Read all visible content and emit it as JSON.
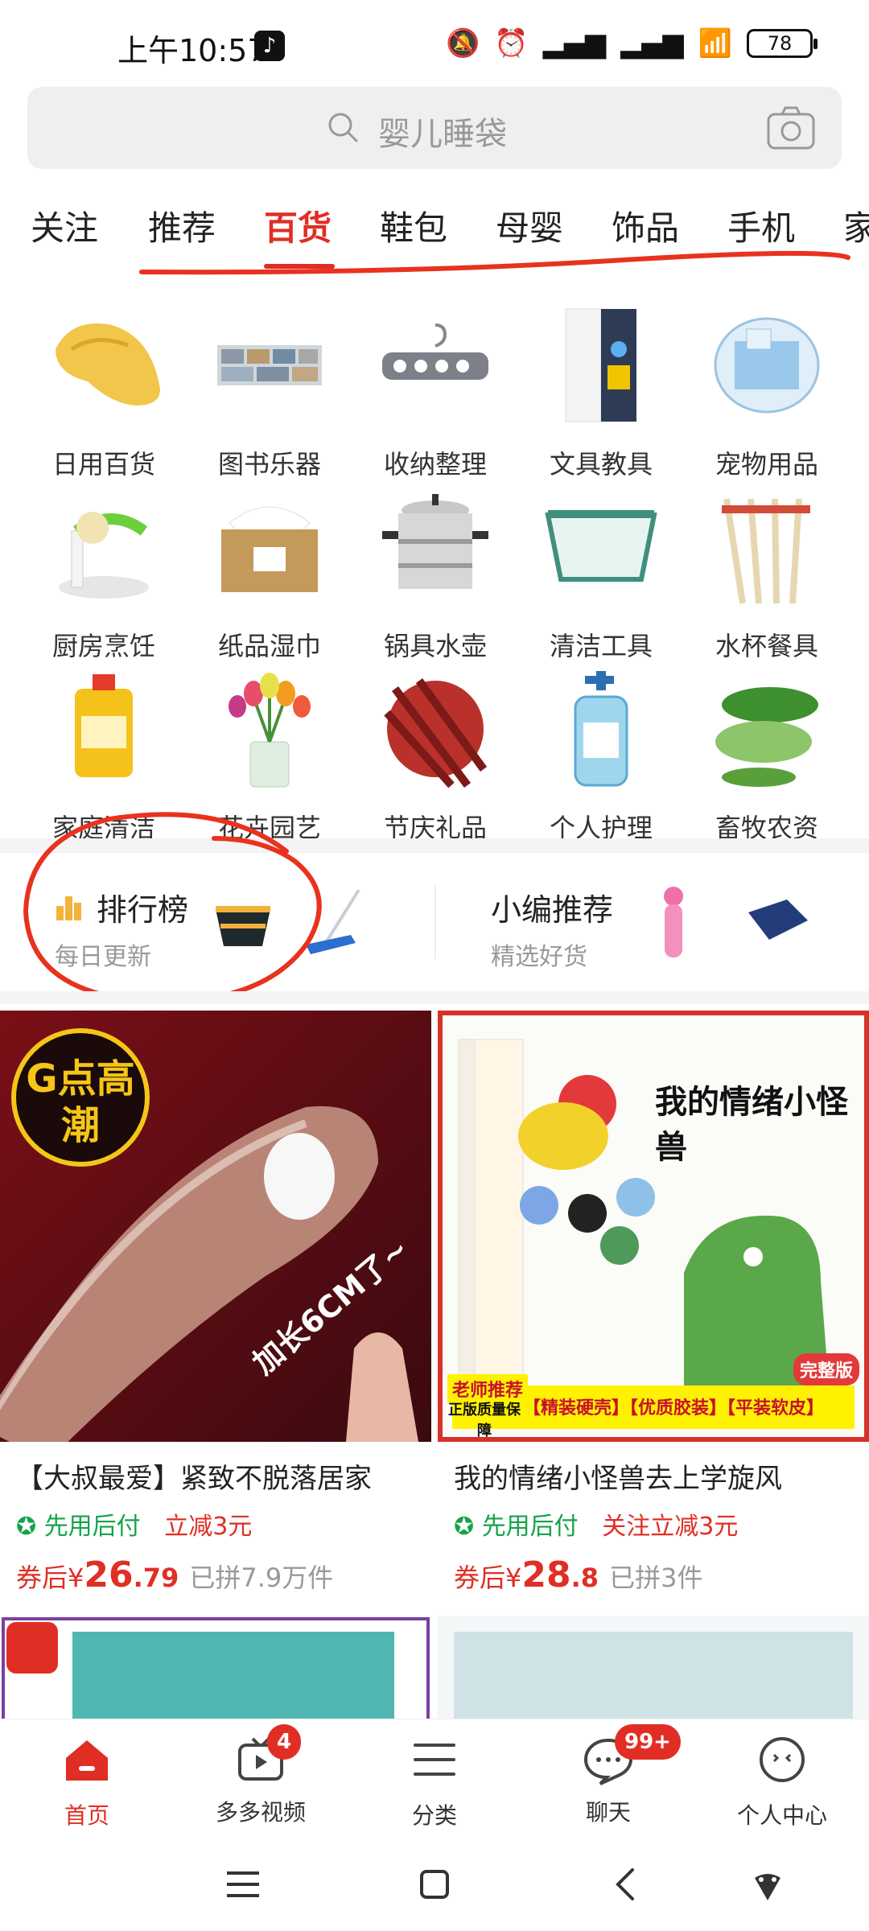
{
  "status_bar": {
    "time": "上午10:57",
    "battery": "78"
  },
  "search": {
    "placeholder": "婴儿睡袋"
  },
  "tabs": [
    {
      "label": "关注"
    },
    {
      "label": "推荐"
    },
    {
      "label": "百货"
    },
    {
      "label": "鞋包"
    },
    {
      "label": "母婴"
    },
    {
      "label": "饰品"
    },
    {
      "label": "手机"
    },
    {
      "label": "家"
    }
  ],
  "active_tab": "百货",
  "categories": [
    {
      "label": "日用百货",
      "icon": "slipper-icon"
    },
    {
      "label": "图书乐器",
      "icon": "books-icon"
    },
    {
      "label": "收纳整理",
      "icon": "hanger-icon"
    },
    {
      "label": "文具教具",
      "icon": "notebook-icon"
    },
    {
      "label": "宠物用品",
      "icon": "pet-cage-icon"
    },
    {
      "label": "厨房烹饪",
      "icon": "peeler-icon"
    },
    {
      "label": "纸品湿巾",
      "icon": "tissue-box-icon"
    },
    {
      "label": "锅具水壶",
      "icon": "steamer-pot-icon"
    },
    {
      "label": "清洁工具",
      "icon": "basin-icon"
    },
    {
      "label": "水杯餐具",
      "icon": "chopsticks-icon"
    },
    {
      "label": "家庭清洁",
      "icon": "detergent-icon"
    },
    {
      "label": "花卉园艺",
      "icon": "tulips-icon"
    },
    {
      "label": "节庆礼品",
      "icon": "firecracker-icon"
    },
    {
      "label": "个人护理",
      "icon": "sanitizer-icon"
    },
    {
      "label": "畜牧农资",
      "icon": "cucumber-icon"
    }
  ],
  "ranking": {
    "title": "排行榜",
    "subtitle": "每日更新"
  },
  "editor": {
    "title": "小编推荐",
    "subtitle": "精选好货"
  },
  "products": [
    {
      "title": "【大叔最爱】紧致不脱落居家",
      "tag_green": "先用后付",
      "tag_red": "立减3元",
      "price_prefix": "券后¥",
      "price_int": "26",
      "price_dec": ".79",
      "sold": "已拼7.9万件",
      "image_text_badge": "G点高潮",
      "image_text_side": "加长6CM了~"
    },
    {
      "title": "我的情绪小怪兽去上学旋风",
      "tag_green": "先用后付",
      "tag_red": "关注立减3元",
      "price_prefix": "券后¥",
      "price_int": "28",
      "price_dec": ".8",
      "sold": "已拼3件",
      "image_text_title": "我的情绪小怪兽",
      "image_text_banner": "【精装硬壳】【优质胶装】【平装软皮】",
      "image_text_badge": "老师推荐",
      "image_text_badge2": "正版质量保障",
      "image_text_corner": "完整版"
    }
  ],
  "tabbar": [
    {
      "label": "首页",
      "icon": "home-icon"
    },
    {
      "label": "多多视频",
      "icon": "video-icon",
      "badge": "4"
    },
    {
      "label": "分类",
      "icon": "category-list-icon"
    },
    {
      "label": "聊天",
      "icon": "chat-icon",
      "badge": "99+"
    },
    {
      "label": "个人中心",
      "icon": "profile-icon"
    }
  ],
  "colors": {
    "accent": "#e02e24",
    "green": "#15a34a"
  }
}
